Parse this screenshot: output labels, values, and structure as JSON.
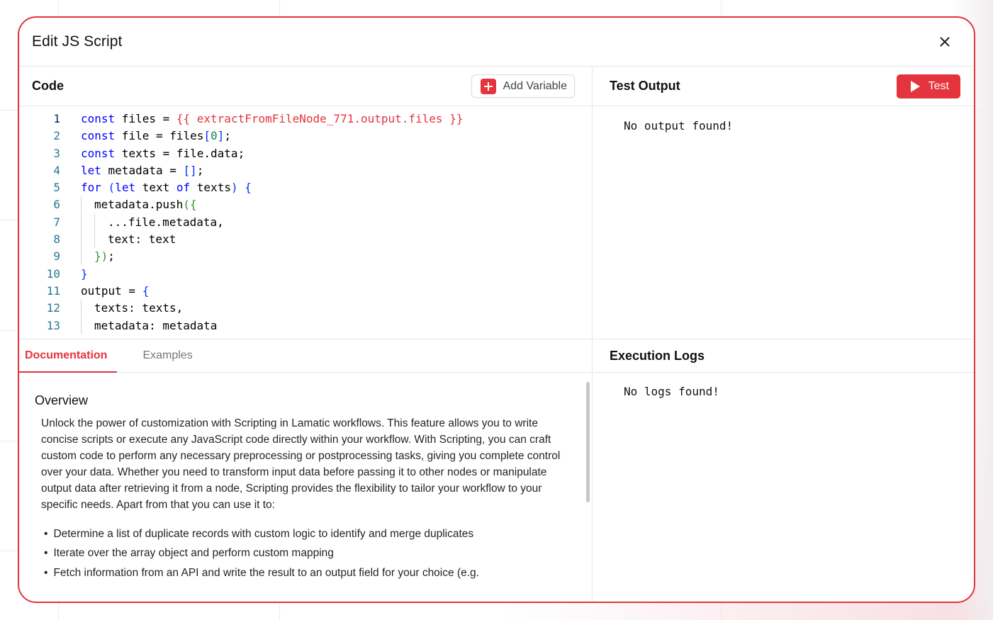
{
  "modal": {
    "title": "Edit JS Script",
    "close_icon": "close-icon"
  },
  "code_pane": {
    "title": "Code",
    "add_variable_label": "Add Variable",
    "lines": [
      {
        "n": "1"
      },
      {
        "n": "2"
      },
      {
        "n": "3"
      },
      {
        "n": "4"
      },
      {
        "n": "5"
      },
      {
        "n": "6"
      },
      {
        "n": "7"
      },
      {
        "n": "8"
      },
      {
        "n": "9"
      },
      {
        "n": "10"
      },
      {
        "n": "11"
      },
      {
        "n": "12"
      },
      {
        "n": "13"
      }
    ],
    "code": {
      "l1_kw": "const",
      "l1_a": " files = ",
      "l1_tpl": "{{ extractFromFileNode_771.output.files }}",
      "l2_kw": "const",
      "l2_a": " file = files",
      "l2_b1": "[",
      "l2_num": "0",
      "l2_b2": "]",
      "l2_c": ";",
      "l3_kw": "const",
      "l3_a": " texts = file.data;",
      "l4_kw": "let",
      "l4_a": " metadata = ",
      "l4_br": "[]",
      "l4_c": ";",
      "l5_kw": "for",
      "l5_a": " ",
      "l5_p1": "(",
      "l5_kw2": "let",
      "l5_b": " text ",
      "l5_kw3": "of",
      "l5_c": " texts",
      "l5_p2": ")",
      "l5_d": " ",
      "l5_br": "{",
      "l6_a": "metadata.push",
      "l6_p": "(",
      "l6_br": "{",
      "l7_a": "...file.metadata,",
      "l8_a": "text: text",
      "l9_br": "}",
      "l9_p": ")",
      "l9_c": ";",
      "l10_br": "}",
      "l11_a": "output = ",
      "l11_br": "{",
      "l12_a": "texts: texts,",
      "l13_a": "metadata: metadata"
    }
  },
  "test_pane": {
    "title": "Test Output",
    "test_label": "Test",
    "output_text": "No output found!"
  },
  "docs": {
    "tabs": [
      {
        "label": "Documentation"
      },
      {
        "label": "Examples"
      }
    ],
    "heading": "Overview",
    "paragraph": "Unlock the power of customization with Scripting in Lamatic workflows. This feature allows you to write concise scripts or execute any JavaScript code directly within your workflow. With Scripting, you can craft custom code to perform any necessary preprocessing or postprocessing tasks, giving you complete control over your data. Whether you need to transform input data before passing it to other nodes or manipulate output data after retrieving it from a node, Scripting provides the flexibility to tailor your workflow to your specific needs. Apart from that you can use it to:",
    "bullets": [
      "Determine a list of duplicate records with custom logic to identify and merge duplicates",
      "Iterate over the array object and perform custom mapping",
      "Fetch information from an API and write the result to an output field for your choice (e.g."
    ]
  },
  "logs_pane": {
    "title": "Execution Logs",
    "logs_text": "No logs found!"
  },
  "colors": {
    "accent": "#e4343d",
    "keyword": "#0000ff",
    "line_number": "#237893"
  }
}
